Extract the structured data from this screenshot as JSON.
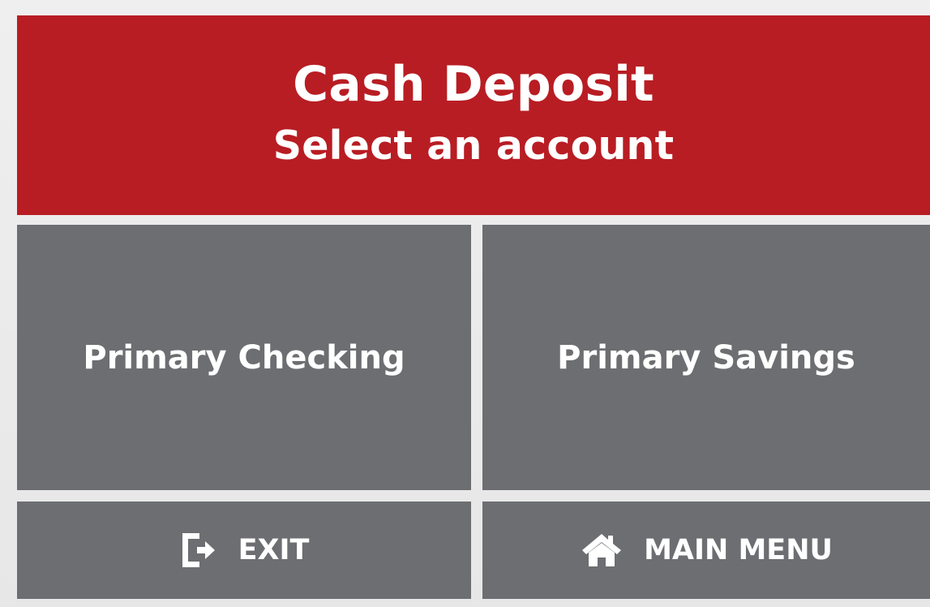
{
  "header": {
    "title": "Cash Deposit",
    "subtitle": "Select an account"
  },
  "accounts": [
    {
      "label": "Primary Checking"
    },
    {
      "label": "Primary Savings"
    }
  ],
  "footer": {
    "exit": {
      "label": "EXIT",
      "icon": "exit-icon"
    },
    "main_menu": {
      "label": "MAIN MENU",
      "icon": "home-icon"
    }
  },
  "colors": {
    "header_bg": "#b81d23",
    "tile_bg": "#6d6e71",
    "text": "#ffffff",
    "background": "#ececec"
  }
}
